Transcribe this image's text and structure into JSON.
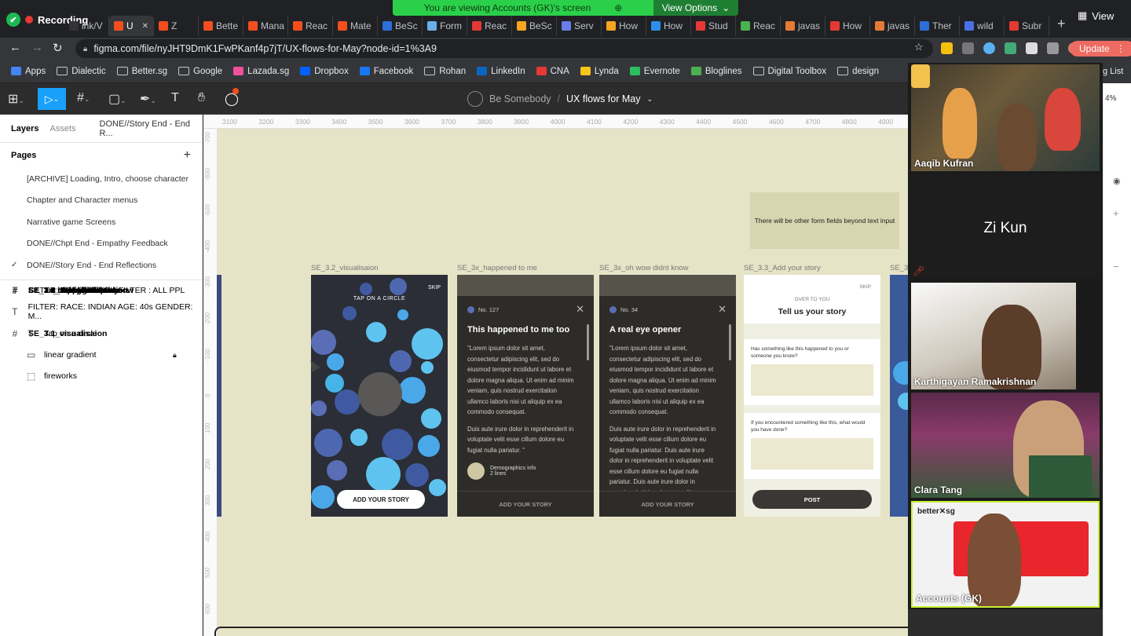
{
  "recording": {
    "label": "Recording"
  },
  "share_banner": {
    "text": "You are viewing Accounts (GK)'s screen",
    "options": "View Options"
  },
  "browser": {
    "tabs": [
      {
        "label": "ink/V",
        "color": "#333333"
      },
      {
        "label": "U",
        "color": "#f24e1e",
        "active": true
      },
      {
        "label": "Z",
        "color": "#f24e1e"
      },
      {
        "label": "Bette",
        "color": "#f24e1e"
      },
      {
        "label": "Mana",
        "color": "#f24e1e"
      },
      {
        "label": "Reac",
        "color": "#f24e1e"
      },
      {
        "label": "Mate",
        "color": "#f24e1e"
      },
      {
        "label": "BeSc",
        "color": "#2c6fd8"
      },
      {
        "label": "Form",
        "color": "#6ab0e8"
      },
      {
        "label": "Reac",
        "color": "#e53935"
      },
      {
        "label": "BeSc",
        "color": "#f5a623"
      },
      {
        "label": "Serv",
        "color": "#6a7de8"
      },
      {
        "label": "How",
        "color": "#f5a623"
      },
      {
        "label": "How",
        "color": "#2c8ee8"
      },
      {
        "label": "Stud",
        "color": "#e53935"
      },
      {
        "label": "Reac",
        "color": "#4caf50"
      },
      {
        "label": "javas",
        "color": "#e57a35"
      },
      {
        "label": "How",
        "color": "#e53935"
      },
      {
        "label": "javas",
        "color": "#e57a35"
      },
      {
        "label": "Ther",
        "color": "#2c6fd8"
      },
      {
        "label": "wild",
        "color": "#4a6fe8"
      },
      {
        "label": "Subr",
        "color": "#e53935"
      }
    ],
    "view_label": "View",
    "url": "figma.com/file/nyJHT9DmK1FwPKanf4p7jT/UX-flows-for-May?node-id=1%3A9",
    "update_label": "Update",
    "bookmarks": [
      "Apps",
      "Dialectic",
      "Better.sg",
      "Google",
      "Lazada.sg",
      "Dropbox",
      "Facebook",
      "Rohan",
      "LinkedIn",
      "CNA",
      "Lynda",
      "Evernote",
      "Bloglines",
      "Digital Toolbox",
      "design"
    ],
    "reading_list": "g List"
  },
  "figma": {
    "team": "Be Somebody",
    "file": "UX flows for May",
    "zoom": "4%",
    "left": {
      "tab_layers": "Layers",
      "tab_assets": "Assets",
      "current_page": "DONE//Story End - End R...",
      "pages_title": "Pages",
      "pages": [
        "[ARCHIVE] Loading, Intro, choose character",
        "Chapter and Character menus",
        "Narrative game Screens",
        "DONE//Chpt End - Empathy Feedback",
        "DONE//Story End - End Reflections"
      ],
      "layers": [
        {
          "icon": "#",
          "label": "SE_1.4_animation"
        },
        {
          "icon": "#",
          "label": "SE_1.3_one filled"
        },
        {
          "icon": "#",
          "label": "SE_1.1_Fade to black"
        },
        {
          "icon": "#",
          "label": "SE_1.0_Story complete"
        },
        {
          "icon": "#",
          "label": "SE_1.2_none filled"
        },
        {
          "icon": "#",
          "label": "SE_3.3_Add your story"
        },
        {
          "icon": "#",
          "label": "SE_3x_oh wow didnt know"
        },
        {
          "icon": "#",
          "label": "SE_3x_happened to me"
        },
        {
          "icon": "#",
          "label": "SE_3.2_visualisaion"
        },
        {
          "icon": "#",
          "label": "SE_3.2_visualisaion"
        },
        {
          "icon": "#",
          "label": "SE_3.4_ending animation"
        },
        {
          "icon": "T",
          "label": "FILTER: PPL LIKE YOU FILTER : ALL PPL"
        },
        {
          "icon": "T",
          "label": "FILTER: RACE: INDIAN AGE: 40s GENDER: M..."
        },
        {
          "icon": "#",
          "label": "SE_3.1_visualisaion"
        }
      ],
      "children": [
        {
          "icon": "T",
          "label": "Tap on a circle"
        },
        {
          "icon": "▭",
          "label": "linear gradient"
        },
        {
          "icon": "⬚",
          "label": "fireworks"
        }
      ]
    },
    "ruler_x": [
      "3100",
      "3200",
      "3300",
      "3400",
      "3500",
      "3600",
      "3700",
      "3800",
      "3900",
      "4000",
      "4100",
      "4200",
      "4300",
      "4400",
      "4500",
      "4600",
      "4700",
      "4800",
      "4900"
    ],
    "ruler_y": [
      "-700",
      "-600",
      "-500",
      "-400",
      "-300",
      "-200",
      "-100",
      "0",
      "100",
      "200",
      "300",
      "400",
      "500",
      "600"
    ],
    "canvas": {
      "note": "There will be other form fields beyond text input",
      "frame_labels": [
        "SE_3.2_visualisaion",
        "SE_3x_happened to me",
        "SE_3x_oh wow didnt know",
        "SE_3.3_Add your story",
        "SE_3"
      ],
      "viz": {
        "skip": "SKIP",
        "tap": "TAP ON A CIRCLE",
        "cta": "ADD YOUR STORY"
      },
      "card1": {
        "num": "No. 127",
        "title": "This happened to me too",
        "p1": "\"Lorem ipsum dolor sit amet, consectetur adipiscing elit, sed do eiusmod tempor incididunt ut labore et dolore magna aliqua. Ut enim ad minim veniam, quis nostrud exercitation ullamco laboris nisi ut aliquip ex ea commodo consequat.",
        "p2": "Duis aute irure dolor in reprehenderit in voluptate velit esse cillum dolore eu fugiat nulla pariatur. \"",
        "demo1": "Demographics info",
        "demo2": "2 lines",
        "cta": "ADD YOUR STORY"
      },
      "card2": {
        "num": "No. 34",
        "title": "A real eye opener",
        "p1": "\"Lorem ipsum dolor sit amet, consectetur adipiscing elit, sed do eiusmod tempor incididunt ut labore et dolore magna aliqua. Ut enim ad minim veniam, quis nostrud exercitation ullamco laboris nisi ut aliquip ex ea commodo consequat.",
        "p2": "Duis aute irure dolor in reprehenderit in voluptate velit esse cillum dolore eu fugiat nulla pariatur. Duis aute irure dolor in reprehenderit in voluptate velit esse cillum dolore eu fugiat nulla pariatur. Duis aute irure dolor in reprehenderit in voluptate velit esse",
        "cta": "ADD YOUR STORY"
      },
      "form": {
        "skip": "SKIP",
        "over": "OVER TO YOU",
        "title": "Tell us your story",
        "q1": "Has something like this happened to you or someone you know?",
        "q2": "If you encountered something like this, what would you have done?",
        "post": "POST"
      }
    }
  },
  "zoom": {
    "participants": [
      {
        "name": "Aaqib Kufran"
      },
      {
        "name": "Zi Kun"
      },
      {
        "name": "Karthigayan Ramakrishnan"
      },
      {
        "name": "Clara Tang"
      },
      {
        "name": "Accounts (GK)"
      }
    ],
    "logo": "better✕sg"
  }
}
